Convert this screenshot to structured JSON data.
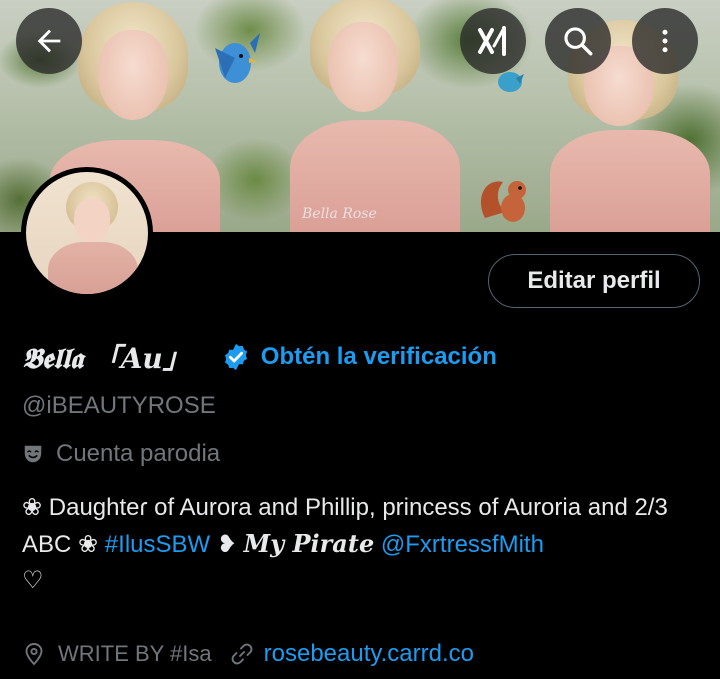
{
  "header": {
    "banner_watermark": "Bella Rose",
    "back_label": "Back",
    "grok_label": "Grok",
    "search_label": "Search",
    "more_label": "More"
  },
  "profile": {
    "edit_button": "Editar perfil",
    "display_name": "𝕭𝖊𝖑𝖑𝖆 「𝑨𝒖」",
    "verify_link": "Obtén la verificación",
    "handle": "@iBEAUTYROSE",
    "parody_label": "Cuenta parodia",
    "bio": {
      "part1": "❀ Daughteɾ of Aurora and Phillip, princess of Auroria and 2/3 ABC ❀ ",
      "hashtag": "#IlusSBW",
      "part2": " ❥ ",
      "pirate": "My Pirate",
      "space": " ",
      "mention": "@FxrtressfMith",
      "end": "♡"
    },
    "location": "WRITE BY #Isa",
    "website": "rosebeauty.carrd.co"
  },
  "colors": {
    "accent": "#1d9bf0",
    "muted": "#71767b",
    "text": "#e7e9ea",
    "background": "#000000"
  }
}
